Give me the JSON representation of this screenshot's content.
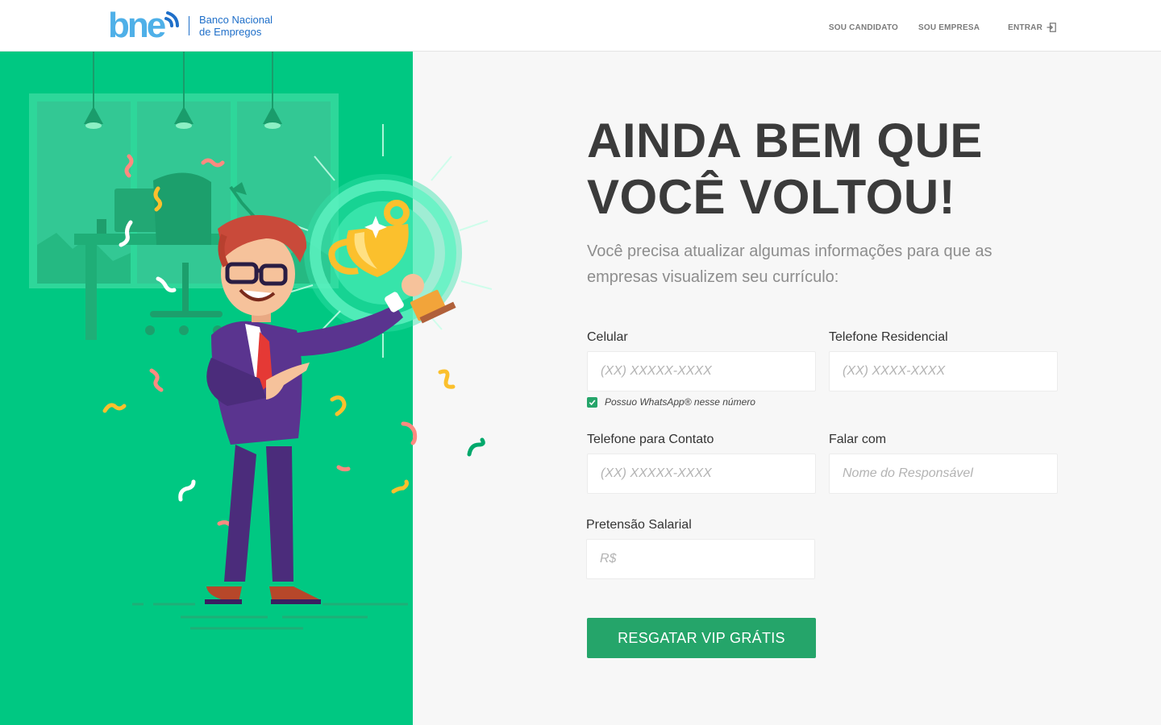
{
  "brand": {
    "logo_text": "bne",
    "name_line1": "Banco Nacional",
    "name_line2": "de Empregos",
    "colors": {
      "blue": "#1f6fc9",
      "lightblue": "#4fb0e8",
      "green": "#00c882",
      "button": "#25a56a"
    }
  },
  "nav": {
    "candidate": "SOU CANDIDATO",
    "company": "SOU EMPRESA",
    "login": "ENTRAR",
    "login_icon": "login-arrow-icon"
  },
  "hero": {
    "title": "AINDA BEM QUE\nVOCÊ VOLTOU!",
    "subtitle": "Você precisa atualizar algumas informações para que as empresas visualizem seu currículo:"
  },
  "form": {
    "celular": {
      "label": "Celular",
      "placeholder": "(XX) XXXXX-XXXX"
    },
    "whatsapp": {
      "label": "Possuo WhatsApp® nesse número",
      "checked": true
    },
    "telefone_residencial": {
      "label": "Telefone Residencial",
      "placeholder": "(XX) XXXX-XXXX"
    },
    "telefone_contato": {
      "label": "Telefone para Contato",
      "placeholder": "(XX) XXXXX-XXXX"
    },
    "falar_com": {
      "label": "Falar com",
      "placeholder": "Nome do Responsável"
    },
    "pretensao": {
      "label": "Pretensão Salarial",
      "placeholder": "R$"
    },
    "submit": "RESGATAR VIP GRÁTIS"
  }
}
